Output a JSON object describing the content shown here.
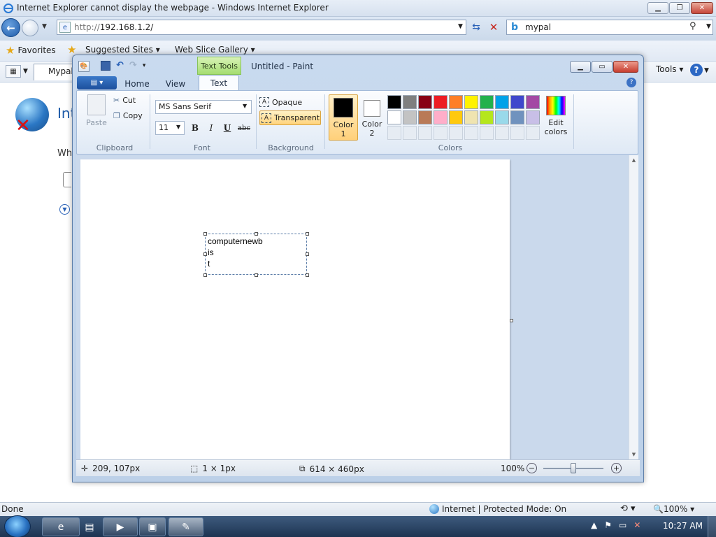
{
  "ie": {
    "title": "Internet Explorer cannot display the webpage - Windows Internet Explorer",
    "address_proto": "http://",
    "address_host": "192.168.1.2/",
    "search_value": "mypal",
    "favorites_label": "Favorites",
    "suggested_sites_label": "Suggested Sites",
    "web_slice_label": "Web Slice Gallery",
    "tab_label": "Mypal",
    "tools_label": "Tools",
    "content_heading": "Int",
    "content_sub": "Wh",
    "status_done": "Done",
    "status_zone": "Internet | Protected Mode: On",
    "status_zoom": "100%"
  },
  "paint": {
    "context_tab_group": "Text Tools",
    "title": "Untitled - Paint",
    "tabs": [
      "Home",
      "View",
      "Text"
    ],
    "clipboard": {
      "paste": "Paste",
      "cut": "Cut",
      "copy": "Copy",
      "group": "Clipboard"
    },
    "font": {
      "name": "MS Sans Serif",
      "size": "11",
      "bold": "B",
      "italic": "I",
      "underline": "U",
      "strike": "abc",
      "group": "Font"
    },
    "background": {
      "opaque": "Opaque",
      "transparent": "Transparent",
      "group": "Background"
    },
    "colors": {
      "color1_label": "Color\n1",
      "color2_label": "Color\n2",
      "edit_label": "Edit\ncolors",
      "group": "Colors",
      "color1": "#000000",
      "color2": "#ffffff",
      "palette": [
        "#000000",
        "#7f7f7f",
        "#880015",
        "#ed1c24",
        "#ff7f27",
        "#fff200",
        "#22b14c",
        "#00a2e8",
        "#3f48cc",
        "#a349a4",
        "#ffffff",
        "#c3c3c3",
        "#b97a57",
        "#ffaec9",
        "#ffc90e",
        "#efe4b0",
        "#b5e61d",
        "#99d9ea",
        "#7092be",
        "#c8bfe7",
        "",
        "",
        "",
        "",
        "",
        "",
        "",
        "",
        "",
        ""
      ]
    },
    "canvas_text": "computernewb\nis\nt",
    "status": {
      "position": "209, 107px",
      "selection": "1 × 1px",
      "size": "614 × 460px",
      "zoom": "100%"
    }
  },
  "taskbar": {
    "clock": "10:27 AM"
  }
}
